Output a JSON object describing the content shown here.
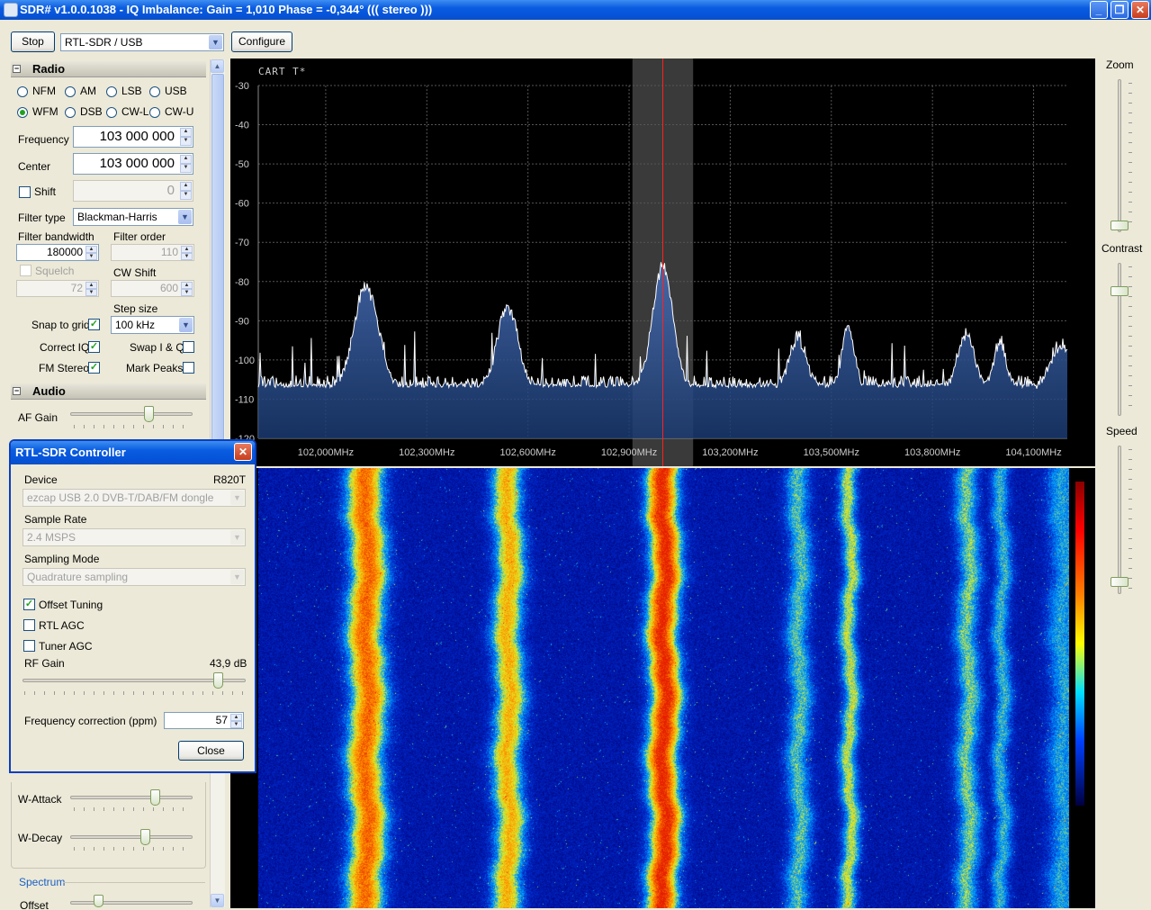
{
  "window": {
    "title": "SDR# v1.0.0.1038 - IQ Imbalance: Gain = 1,010 Phase = -0,344° ((( stereo )))"
  },
  "toolbar": {
    "stop_label": "Stop",
    "source": "RTL-SDR / USB",
    "configure_label": "Configure"
  },
  "radio": {
    "header": "Radio",
    "modes": [
      {
        "label": "NFM",
        "selected": false
      },
      {
        "label": "AM",
        "selected": false
      },
      {
        "label": "LSB",
        "selected": false
      },
      {
        "label": "USB",
        "selected": false
      },
      {
        "label": "WFM",
        "selected": true
      },
      {
        "label": "DSB",
        "selected": false
      },
      {
        "label": "CW-L",
        "selected": false
      },
      {
        "label": "CW-U",
        "selected": false
      }
    ],
    "frequency_label": "Frequency",
    "frequency_value": "103 000 000",
    "center_label": "Center",
    "center_value": "103 000 000",
    "shift_label": "Shift",
    "shift_value": "0",
    "filter_type_label": "Filter type",
    "filter_type_value": "Blackman-Harris",
    "filter_bandwidth_label": "Filter bandwidth",
    "filter_bandwidth_value": "180000",
    "filter_order_label": "Filter order",
    "filter_order_value": "110",
    "squelch_label": "Squelch",
    "squelch_value": "72",
    "cw_shift_label": "CW Shift",
    "cw_shift_value": "600",
    "step_size_label": "Step size",
    "step_size_value": "100 kHz",
    "snap_to_grid_label": "Snap to grid",
    "correct_iq_label": "Correct IQ",
    "swap_iq_label": "Swap I & Q",
    "fm_stereo_label": "FM Stereo",
    "mark_peaks_label": "Mark Peaks"
  },
  "audio": {
    "header": "Audio",
    "af_gain_label": "AF Gain",
    "af_gain_level": 0.65
  },
  "lower_panel": {
    "w_attack_label": "W-Attack",
    "w_attack_level": 0.7,
    "w_decay_label": "W-Decay",
    "w_decay_level": 0.62,
    "spectrum_header": "Spectrum",
    "offset_label": "Offset"
  },
  "right_panel": {
    "zoom_label": "Zoom",
    "contrast_label": "Contrast",
    "speed_label": "Speed"
  },
  "dialog": {
    "title": "RTL-SDR Controller",
    "device_label": "Device",
    "device_tuner": "R820T",
    "device_value": "ezcap USB 2.0 DVB-T/DAB/FM dongle",
    "sample_rate_label": "Sample Rate",
    "sample_rate_value": "2.4 MSPS",
    "sampling_mode_label": "Sampling Mode",
    "sampling_mode_value": "Quadrature sampling",
    "offset_tuning_label": "Offset Tuning",
    "offset_tuning_checked": true,
    "rtl_agc_label": "RTL AGC",
    "rtl_agc_checked": false,
    "tuner_agc_label": "Tuner AGC",
    "tuner_agc_checked": false,
    "rf_gain_label": "RF Gain",
    "rf_gain_value": "43,9 dB",
    "rf_gain_level": 0.88,
    "freq_correction_label": "Frequency correction (ppm)",
    "freq_correction_value": "57",
    "close_label": "Close"
  },
  "colors": {
    "spectrum_bg": "#000000",
    "spectrum_fill": "#1a3a70",
    "tuned_line": "#ff2020",
    "title_blue": "#0553d8"
  },
  "chart_data": {
    "type": "area",
    "title": "CART T*",
    "ylim": [
      -120,
      -30
    ],
    "y_ticks": [
      "-30",
      "-40",
      "-50",
      "-60",
      "-70",
      "-80",
      "-90",
      "-100",
      "-110",
      "-120"
    ],
    "x_tick_labels": [
      "102,000MHz",
      "102,300MHz",
      "102,600MHz",
      "102,900MHz",
      "103,200MHz",
      "103,500MHz",
      "103,800MHz",
      "104,100MHz"
    ],
    "x_range_mhz": [
      101.8,
      104.2
    ],
    "tuned_mhz": 103.0,
    "filter_bandwidth_mhz": 0.18,
    "noise_floor_db": -107,
    "peaks": [
      {
        "freq_mhz": 102.12,
        "level_db": -81,
        "width_mhz": 0.06
      },
      {
        "freq_mhz": 102.54,
        "level_db": -86,
        "width_mhz": 0.05
      },
      {
        "freq_mhz": 103.0,
        "level_db": -76,
        "width_mhz": 0.05
      },
      {
        "freq_mhz": 103.4,
        "level_db": -94,
        "width_mhz": 0.04
      },
      {
        "freq_mhz": 103.55,
        "level_db": -91,
        "width_mhz": 0.03
      },
      {
        "freq_mhz": 103.9,
        "level_db": -93,
        "width_mhz": 0.04
      },
      {
        "freq_mhz": 104.0,
        "level_db": -95,
        "width_mhz": 0.03
      },
      {
        "freq_mhz": 104.18,
        "level_db": -96,
        "width_mhz": 0.05
      }
    ]
  }
}
